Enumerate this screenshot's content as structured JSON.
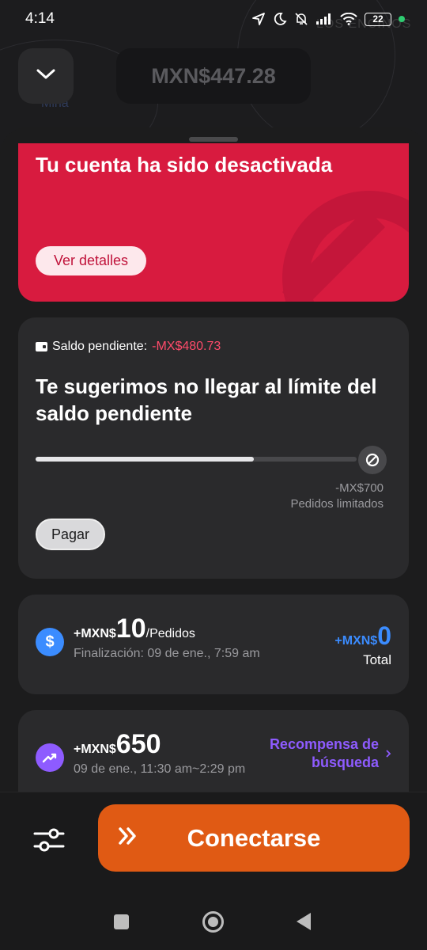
{
  "status_bar": {
    "time": "4:14",
    "battery": "22"
  },
  "map": {
    "label_1": "Mina",
    "label_2": "LOS ENCINOS"
  },
  "header": {
    "balance": "MXN$447.28"
  },
  "alert": {
    "title": "Tu cuenta ha sido desactivada",
    "details_button": "Ver detalles"
  },
  "pending": {
    "label": "Saldo pendiente:",
    "amount": "-MX$480.73",
    "headline": "Te sugerimos no llegar al límite del saldo pendiente",
    "progress_fraction": 0.68,
    "limit_value": "-MX$700",
    "limit_note": "Pedidos limitados",
    "pay_button": "Pagar"
  },
  "reward_1": {
    "prefix": "+MXN$",
    "value": "10",
    "suffix": "/Pedidos",
    "subtitle": "Finalización: 09 de ene., 7:59 am",
    "total_prefix": "+MXN$",
    "total_value": "0",
    "total_label": "Total"
  },
  "reward_2": {
    "prefix": "+MXN$",
    "value": "650",
    "subtitle": "09 de ene., 11:30 am~2:29 pm",
    "link": "Recompensa de búsqueda"
  },
  "actions": {
    "connect_button": "Conectarse"
  },
  "colors": {
    "alert_red": "#d81b3f",
    "connect_orange": "#e05a14",
    "reward_blue": "#3b8cff",
    "reward_purple": "#8e5bff"
  }
}
